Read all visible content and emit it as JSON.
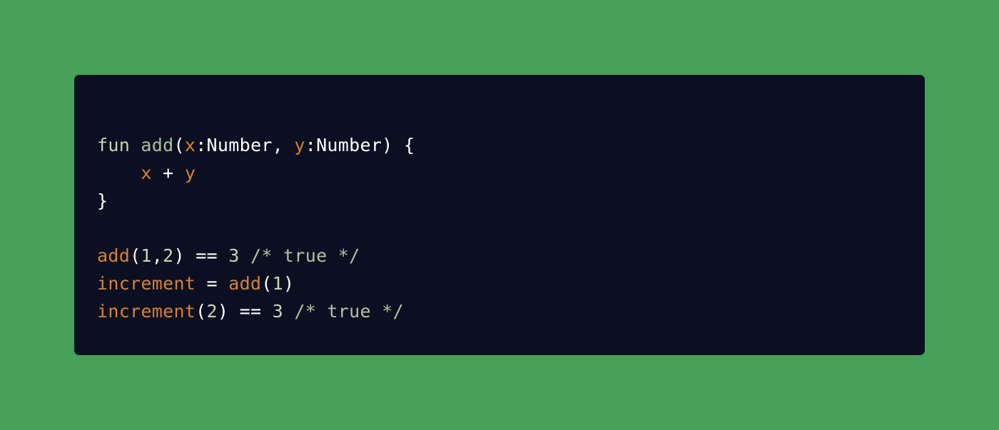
{
  "theme": {
    "background": "#47a159",
    "panel": "#0c0f21",
    "colors": {
      "keyword": "#c8d5b3",
      "function": "#a7c29a",
      "plain": "#ffffff",
      "variable": "#d8822f",
      "number": "#c8d5b3",
      "comment": "#b0c3a0"
    }
  },
  "code": {
    "lines": [
      [
        {
          "text": "fun ",
          "kind": "keyword"
        },
        {
          "text": "add",
          "kind": "function"
        },
        {
          "text": "(",
          "kind": "plain"
        },
        {
          "text": "x",
          "kind": "variable"
        },
        {
          "text": ":Number, ",
          "kind": "plain"
        },
        {
          "text": "y",
          "kind": "variable"
        },
        {
          "text": ":Number) {",
          "kind": "plain"
        }
      ],
      [
        {
          "text": "    ",
          "kind": "plain"
        },
        {
          "text": "x",
          "kind": "variable"
        },
        {
          "text": " + ",
          "kind": "plain"
        },
        {
          "text": "y",
          "kind": "variable"
        }
      ],
      [
        {
          "text": "}",
          "kind": "plain"
        }
      ],
      [],
      [
        {
          "text": "add",
          "kind": "variable"
        },
        {
          "text": "(",
          "kind": "plain"
        },
        {
          "text": "1",
          "kind": "number"
        },
        {
          "text": ",",
          "kind": "plain"
        },
        {
          "text": "2",
          "kind": "number"
        },
        {
          "text": ") ",
          "kind": "plain"
        },
        {
          "text": "==",
          "kind": "plain"
        },
        {
          "text": " ",
          "kind": "plain"
        },
        {
          "text": "3",
          "kind": "number"
        },
        {
          "text": " /* true */",
          "kind": "comment"
        }
      ],
      [
        {
          "text": "increment",
          "kind": "variable"
        },
        {
          "text": " = ",
          "kind": "plain"
        },
        {
          "text": "add",
          "kind": "variable"
        },
        {
          "text": "(",
          "kind": "plain"
        },
        {
          "text": "1",
          "kind": "number"
        },
        {
          "text": ")",
          "kind": "plain"
        }
      ],
      [
        {
          "text": "increment",
          "kind": "variable"
        },
        {
          "text": "(",
          "kind": "plain"
        },
        {
          "text": "2",
          "kind": "number"
        },
        {
          "text": ") ",
          "kind": "plain"
        },
        {
          "text": "==",
          "kind": "plain"
        },
        {
          "text": " ",
          "kind": "plain"
        },
        {
          "text": "3",
          "kind": "number"
        },
        {
          "text": " /* true */",
          "kind": "comment"
        }
      ]
    ]
  }
}
